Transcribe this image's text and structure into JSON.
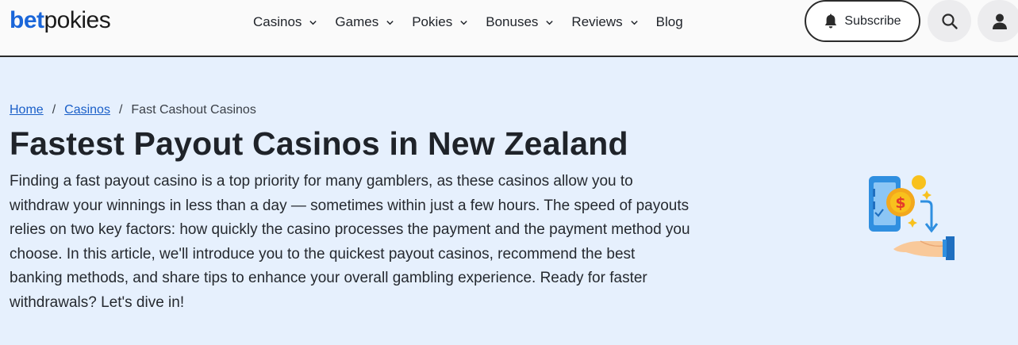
{
  "brand": {
    "logo_part1": "bet",
    "logo_part2": "pokies"
  },
  "nav": {
    "items": [
      {
        "label": "Casinos",
        "has_dropdown": true
      },
      {
        "label": "Games",
        "has_dropdown": true
      },
      {
        "label": "Pokies",
        "has_dropdown": true
      },
      {
        "label": "Bonuses",
        "has_dropdown": true
      },
      {
        "label": "Reviews",
        "has_dropdown": true
      },
      {
        "label": "Blog",
        "has_dropdown": false
      }
    ],
    "subscribe_label": "Subscribe"
  },
  "breadcrumb": {
    "home": "Home",
    "casinos": "Casinos",
    "current": "Fast Cashout Casinos",
    "separator": "/"
  },
  "hero": {
    "title": "Fastest Payout Casinos in New Zealand",
    "intro": "Finding a fast payout casino is a top priority for many gamblers, as these casinos allow you to withdraw your winnings in less than a day — sometimes within just a few hours. The speed of payouts relies on two key factors: how quickly the casino processes the payment and the payment method you choose. In this article, we'll introduce you to the quickest payout casinos, recommend the best banking methods, and share tips to enhance your overall gambling experience. Ready for faster withdrawals? Let's dive in!"
  },
  "icons": {
    "bell": "bell-icon",
    "search": "search-icon",
    "user": "user-icon",
    "chevron": "chevron-down-icon",
    "illustration": "phone-payout-illustration"
  },
  "colors": {
    "brand_blue": "#1a66d9",
    "page_background": "#e6f0fd",
    "link": "#1a5fc8",
    "header_background": "#fafafa"
  }
}
